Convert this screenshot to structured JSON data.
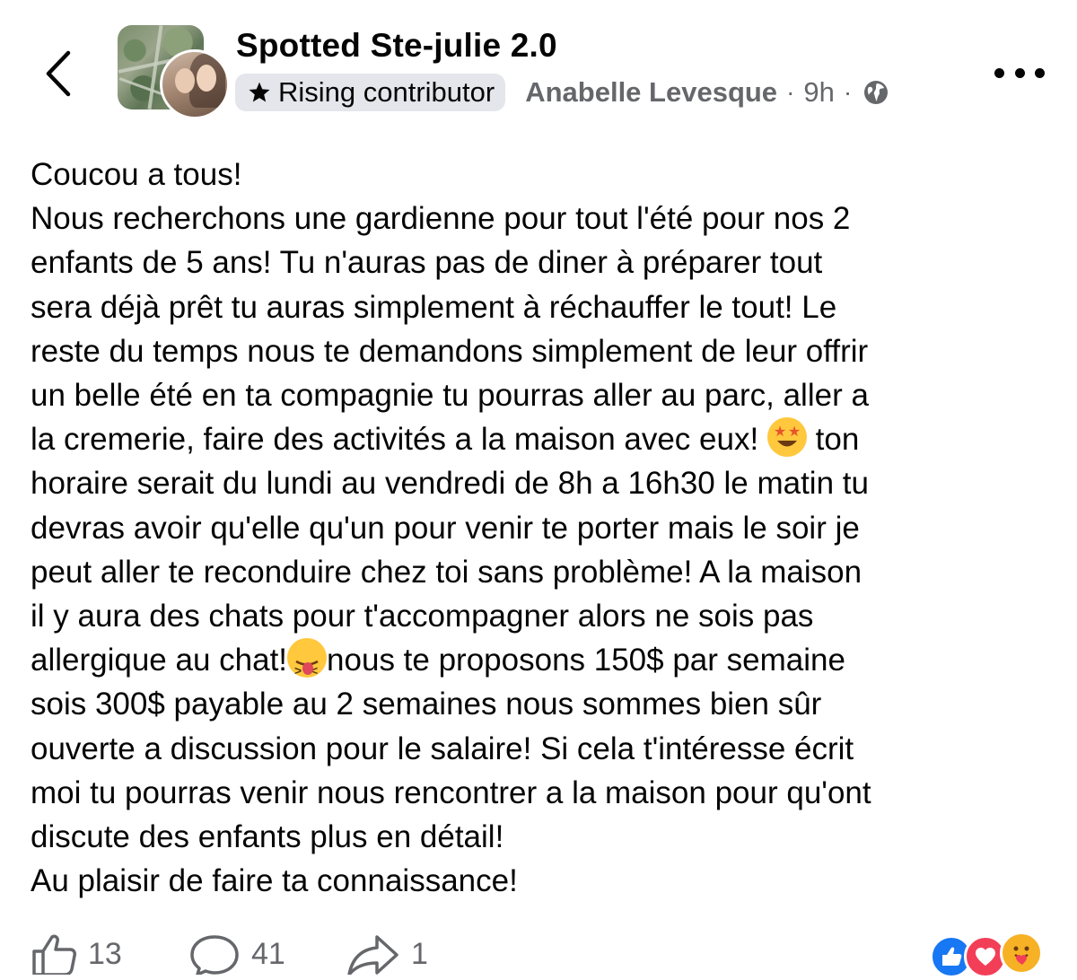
{
  "header": {
    "group_name": "Spotted Ste-julie 2.0",
    "badge_label": "Rising contributor",
    "badge_icon": "star-icon",
    "author": "Anabelle Levesque",
    "separator": "·",
    "time": "9h",
    "privacy_icon": "globe-icon"
  },
  "post": {
    "lines": [
      "Coucou a tous!",
      "Nous recherchons une gardienne pour tout l'été pour nos 2",
      "enfants de 5 ans! Tu n'auras pas de diner à préparer tout",
      "sera déjà prêt tu auras simplement à réchauffer le tout! Le",
      "reste du temps nous te demandons simplement de leur offrir",
      "un belle été en ta compagnie tu pourras aller au parc, aller a",
      "la cremerie, faire des activités a la maison avec eux!",
      "ton",
      "horaire serait du lundi au vendredi de 8h a 16h30 le matin tu",
      "devras avoir qu'elle qu'un pour venir te porter mais le soir je",
      "peut aller te reconduire chez toi sans problème! A la maison",
      "il y aura des chats pour t'accompagner alors ne sois pas",
      "allergique au chat!",
      "nous te proposons 150$ par semaine",
      "sois 300$ payable au 2 semaines nous sommes bien sûr",
      "ouverte a discussion pour le salaire! Si cela t'intéresse écrit",
      "moi tu pourras venir nous rencontrer a la maison pour qu'ont",
      "discute des enfants plus en détail!",
      "Au plaisir de faire ta connaissance!"
    ],
    "emoji_1": "star-struck-emoji",
    "emoji_2": "squinting-tongue-emoji"
  },
  "footer": {
    "likes": "13",
    "comments": "41",
    "shares": "1",
    "reactions": [
      "like-icon",
      "love-icon",
      "care-icon"
    ],
    "colors": {
      "like": "#1877f2",
      "love": "#f33e58",
      "care": "#f7b125"
    }
  }
}
